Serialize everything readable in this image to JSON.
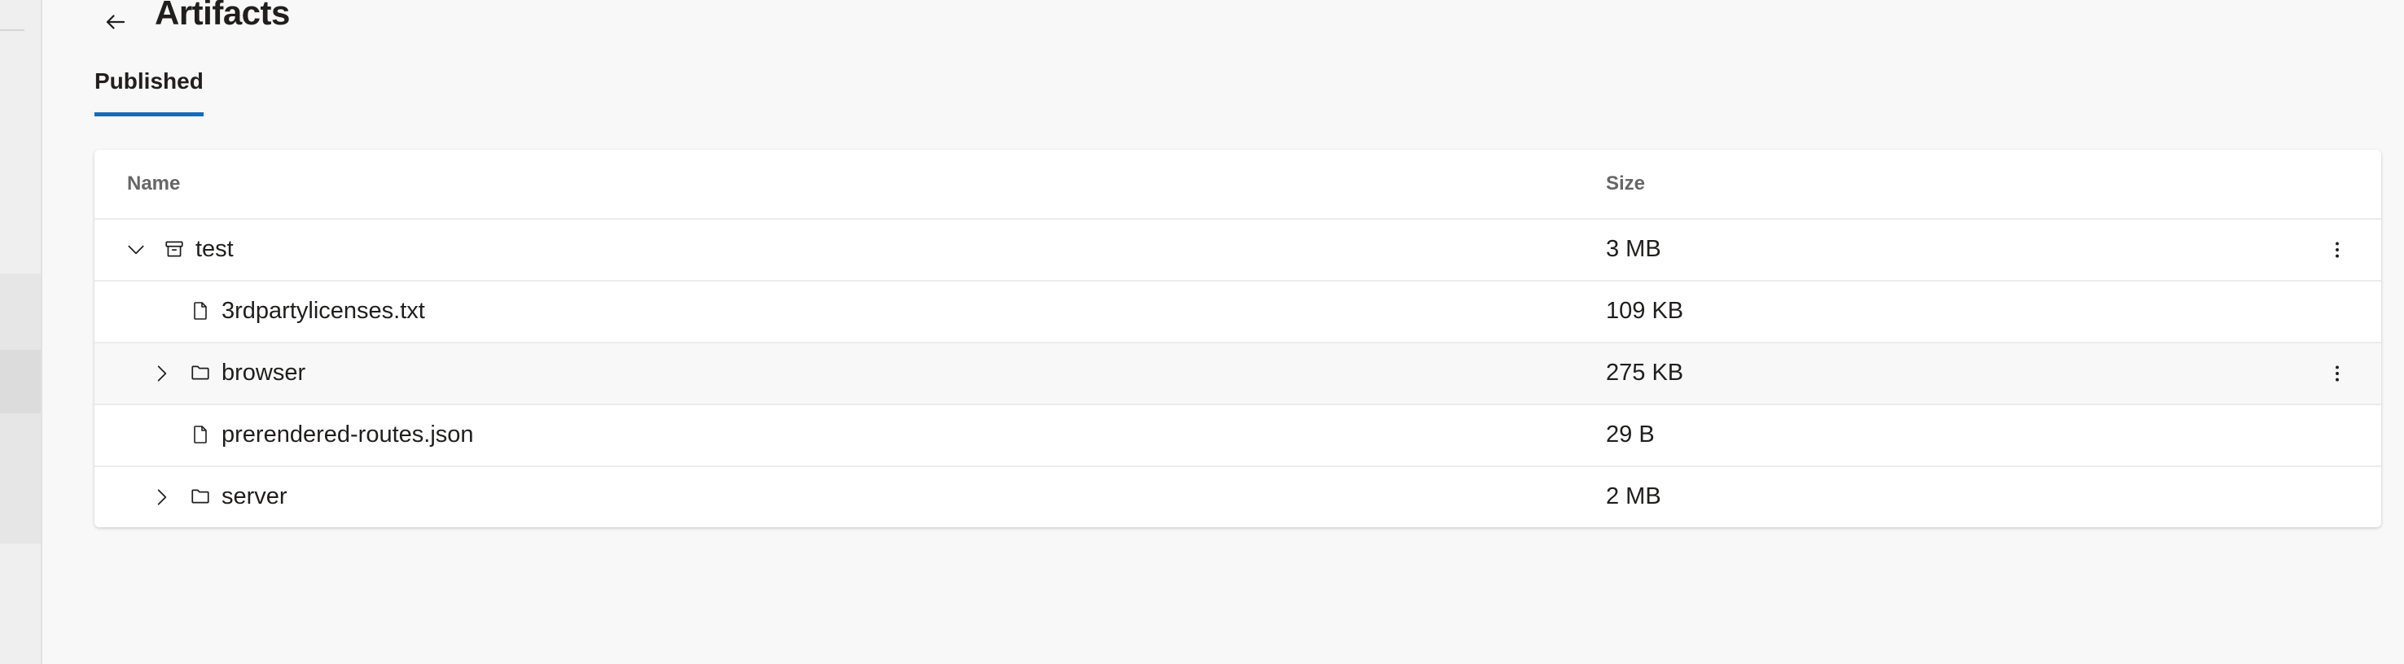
{
  "page": {
    "title": "Artifacts"
  },
  "tabs": [
    {
      "label": "Published"
    }
  ],
  "table": {
    "columns": {
      "name": "Name",
      "size": "Size"
    },
    "rows": [
      {
        "name": "test",
        "size": "3 MB",
        "type": "archive",
        "expanded": true
      },
      {
        "name": "3rdpartylicenses.txt",
        "size": "109 KB",
        "type": "file"
      },
      {
        "name": "browser",
        "size": "275 KB",
        "type": "folder",
        "expanded": false
      },
      {
        "name": "prerendered-routes.json",
        "size": "29 B",
        "type": "file"
      },
      {
        "name": "server",
        "size": "2 MB",
        "type": "folder",
        "expanded": false
      }
    ]
  },
  "colors": {
    "accent": "#0f6cbd",
    "background": "#f8f8f8",
    "card": "#ffffff"
  }
}
